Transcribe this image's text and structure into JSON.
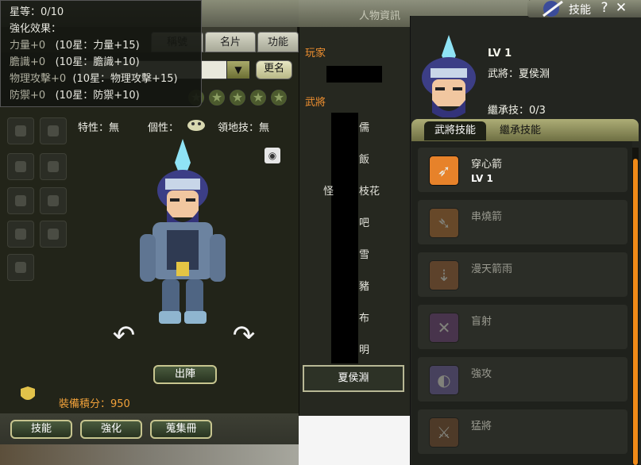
{
  "character_window": {
    "tabs": [
      "名片",
      "功能"
    ],
    "obscured_tab": "稱號",
    "rename_button": "更名",
    "traits": {
      "trait": "特性：無",
      "personality": "個性：",
      "territory_skill": "領地技：無"
    },
    "deploy_button": "出陣",
    "equip_score": "裝備積分：950",
    "bottom_buttons": [
      "技能",
      "強化",
      "蒐集冊"
    ],
    "star_count_shown": 5
  },
  "tooltip": {
    "stars": "星等：0/10",
    "effect_header": "強化效果：",
    "lines": [
      {
        "current": "力量+0",
        "max": "(10星：力量+15)"
      },
      {
        "current": "膽識+0",
        "max": "(10星：膽識+10)"
      },
      {
        "current": "物理攻擊+0",
        "max": "(10星：物理攻擊+15)"
      },
      {
        "current": "防禦+0",
        "max": "(10星：防禦+10)"
      }
    ]
  },
  "info_window": {
    "title": "人物資訊",
    "player_label": "玩家",
    "general_label": "武將",
    "general_names": [
      "儒",
      "飯",
      "枝花",
      "吧",
      "雪",
      "豬",
      "布",
      "明"
    ],
    "left_fragment": "怪",
    "current_general_button": "夏侯淵"
  },
  "skill_window": {
    "title": "技能",
    "help_icon": "?",
    "close_icon": "✕",
    "level": "LV 1",
    "general": "武將：夏侯淵",
    "inherit": "繼承技：0/3",
    "tabs": [
      "武將技能",
      "繼承技能"
    ],
    "skills": [
      {
        "name": "穿心箭",
        "level": "LV 1",
        "active": true,
        "icon": "arrow-pierce-icon",
        "color": "#e7822a"
      },
      {
        "name": "串燒箭",
        "level": "",
        "active": false,
        "icon": "arrow-skewer-icon",
        "color": "#b06a2c"
      },
      {
        "name": "漫天箭雨",
        "level": "",
        "active": false,
        "icon": "arrow-rain-icon",
        "color": "#9a5d32"
      },
      {
        "name": "盲射",
        "level": "",
        "active": false,
        "icon": "blind-shot-icon",
        "color": "#6b3e7a"
      },
      {
        "name": "強攻",
        "level": "",
        "active": false,
        "icon": "strong-attack-icon",
        "color": "#6a5aa0"
      },
      {
        "name": "猛將",
        "level": "",
        "active": false,
        "icon": "fierce-general-icon",
        "color": "#7a4a2a"
      }
    ]
  },
  "colors": {
    "accent_orange": "#f09030",
    "scroll_orange": "#f08a18",
    "star_green": "#4c5a2e"
  }
}
